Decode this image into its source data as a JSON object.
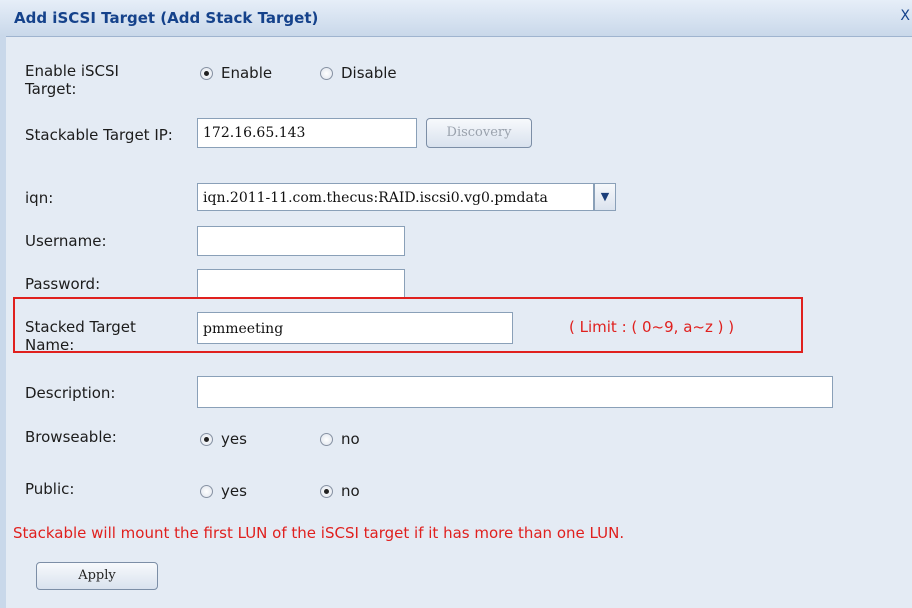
{
  "dialog": {
    "title": "Add iSCSI Target (Add Stack Target)",
    "close_glyph": "X"
  },
  "fields": {
    "enable": {
      "label": "Enable iSCSI Target:",
      "options": [
        "Enable",
        "Disable"
      ],
      "selected": "Enable"
    },
    "stackable_ip": {
      "label": "Stackable Target IP:",
      "value": "172.16.65.143",
      "discovery_label": "Discovery"
    },
    "iqn": {
      "label": "iqn:",
      "value": "iqn.2011-11.com.thecus:RAID.iscsi0.vg0.pmdata"
    },
    "username": {
      "label": "Username:",
      "value": ""
    },
    "password": {
      "label": "Password:",
      "value": ""
    },
    "stacked_name": {
      "label": "Stacked Target Name:",
      "value": "pmmeeting",
      "limit": "( Limit : ( 0~9, a~z ) )"
    },
    "description": {
      "label": "Description:",
      "value": ""
    },
    "browseable": {
      "label": "Browseable:",
      "options": [
        "yes",
        "no"
      ],
      "selected": "yes"
    },
    "public": {
      "label": "Public:",
      "options": [
        "yes",
        "no"
      ],
      "selected": "no"
    }
  },
  "notice": "Stackable will mount the first LUN of the iSCSI target if it has more than one LUN.",
  "apply_label": "Apply",
  "colors": {
    "accent": "#15428b",
    "warning": "#e0201e",
    "background": "#e4ebf4"
  }
}
